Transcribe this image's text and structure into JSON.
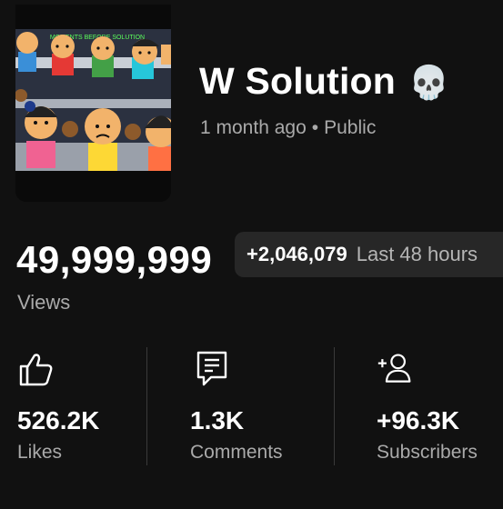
{
  "video": {
    "title": "W Solution",
    "title_emoji": "💀",
    "age": "1 month ago",
    "separator": "•",
    "visibility": "Public",
    "thumbnail_banner": "MOMENTS BEFORE SOLUTION"
  },
  "views": {
    "count": "49,999,999",
    "label": "Views",
    "delta": "+2,046,079",
    "delta_label": "Last 48 hours"
  },
  "stats": [
    {
      "value": "526.2K",
      "label": "Likes",
      "icon": "thumbs-up-icon"
    },
    {
      "value": "1.3K",
      "label": "Comments",
      "icon": "comment-icon"
    },
    {
      "value": "+96.3K",
      "label": "Subscribers",
      "icon": "add-person-icon"
    }
  ],
  "colors": {
    "background": "#111111",
    "pill": "#272727",
    "secondary_text": "#aaaaaa"
  }
}
